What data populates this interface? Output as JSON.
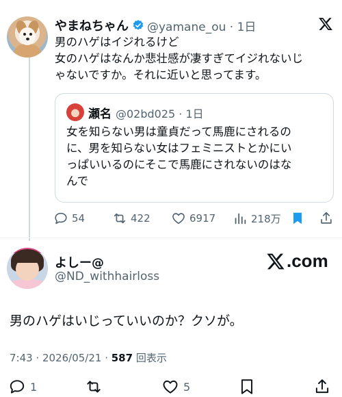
{
  "embedded_post": {
    "author_name": "やまねちゃん",
    "handle_time": "@yamane_ou · 1日",
    "text_lines": [
      "男のハゲはイジれるけど",
      "女のハゲはなんか悲壮感が凄すぎてイジれないじ",
      "ゃないですか。それに近いと思ってます。"
    ],
    "quoted": {
      "author_name": "瀬名",
      "handle_time": "@02bd025 · 1日",
      "text_lines": [
        "女を知らない男は童貞だって馬鹿にされるの",
        "に、男を知らない女はフェミニストとかにい",
        "っぱいいるのにそこで馬鹿にされないのはな",
        "んで"
      ]
    },
    "actions": {
      "replies": "54",
      "reposts": "422",
      "likes": "6917",
      "views": "218万"
    }
  },
  "main_post": {
    "author_name": "よしー@",
    "handle": "@ND_withhairloss",
    "watermark": ".com",
    "text": "男のハゲはいじっていいのか？クソが。",
    "meta": {
      "time_date": "7:43 · 2026/05/21 · ",
      "views_count": "587",
      "views_label": " 回表示"
    },
    "actions": {
      "replies": "1",
      "likes": "5"
    }
  },
  "colors": {
    "text": "#0f1419",
    "secondary": "#536471",
    "accent": "#1d9bf0",
    "border": "#cfd9de"
  },
  "icons": [
    "verified-badge-icon",
    "x-logo-icon",
    "reply-icon",
    "repost-icon",
    "like-icon",
    "views-icon",
    "bookmark-icon",
    "share-icon"
  ]
}
